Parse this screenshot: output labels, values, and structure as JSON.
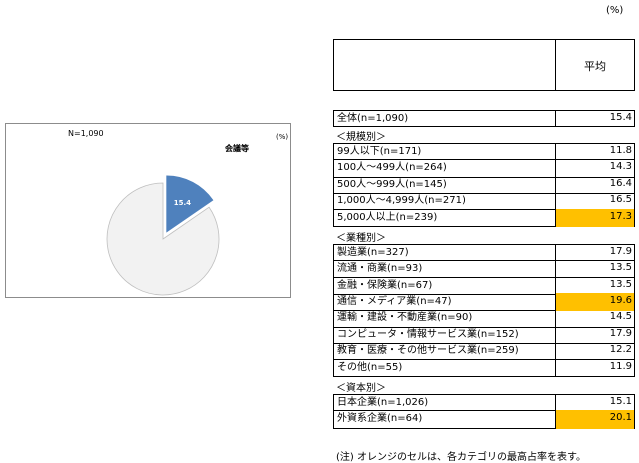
{
  "chart_data": {
    "type": "pie",
    "n_label": "N=1,090",
    "unit_label": "(%)",
    "slices": [
      {
        "name": "会議等",
        "value": 15.4,
        "color": "#4f81bd",
        "value_label": "15.4"
      },
      {
        "name": "",
        "value": 84.6,
        "color": "#f2f2f2"
      }
    ]
  },
  "table": {
    "unit": "(%)",
    "header": "平均",
    "overall": {
      "label": "全体(n=1,090)",
      "value": "15.4",
      "highlight": false
    },
    "sections": [
      {
        "title": "＜規模別＞",
        "rows": [
          {
            "label": "99人以下(n=171)",
            "value": "11.8",
            "highlight": false
          },
          {
            "label": "100人～499人(n=264)",
            "value": "14.3",
            "highlight": false
          },
          {
            "label": "500人～999人(n=145)",
            "value": "16.4",
            "highlight": false
          },
          {
            "label": "1,000人～4,999人(n=271)",
            "value": "16.5",
            "highlight": false
          },
          {
            "label": "5,000人以上(n=239)",
            "value": "17.3",
            "highlight": true
          }
        ]
      },
      {
        "title": "＜業種別＞",
        "rows": [
          {
            "label": "製造業(n=327)",
            "value": "17.9",
            "highlight": false
          },
          {
            "label": "流通・商業(n=93)",
            "value": "13.5",
            "highlight": false
          },
          {
            "label": "金融・保険業(n=67)",
            "value": "13.5",
            "highlight": false
          },
          {
            "label": "通信・メディア業(n=47)",
            "value": "19.6",
            "highlight": true
          },
          {
            "label": "運輸・建設・不動産業(n=90)",
            "value": "14.5",
            "highlight": false
          },
          {
            "label": "コンピュータ・情報サービス業(n=152)",
            "value": "17.9",
            "highlight": false
          },
          {
            "label": "教育・医療・その他サービス業(n=259)",
            "value": "12.2",
            "highlight": false
          },
          {
            "label": "その他(n=55)",
            "value": "11.9",
            "highlight": false
          }
        ]
      },
      {
        "title": "＜資本別＞",
        "rows": [
          {
            "label": "日本企業(n=1,026)",
            "value": "15.1",
            "highlight": false
          },
          {
            "label": "外資系企業(n=64)",
            "value": "20.1",
            "highlight": true
          }
        ]
      }
    ],
    "note": "(注) オレンジのセルは、各カテゴリの最高占率を表す。"
  }
}
